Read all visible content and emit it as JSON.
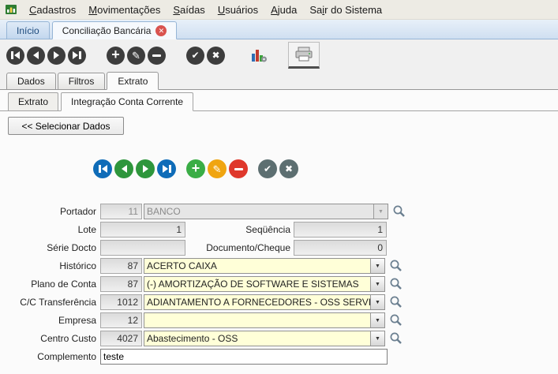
{
  "icons": {
    "close": "✕",
    "plus": "+",
    "pencil": "✎",
    "check": "✔",
    "cancel": "✖",
    "dropdown": "▼"
  },
  "menu": {
    "items": [
      {
        "pre": "",
        "key": "C",
        "rest": "adastros"
      },
      {
        "pre": "",
        "key": "M",
        "rest": "ovimentações"
      },
      {
        "pre": "",
        "key": "S",
        "rest": "aídas"
      },
      {
        "pre": "",
        "key": "U",
        "rest": "suários"
      },
      {
        "pre": "",
        "key": "A",
        "rest": "juda"
      },
      {
        "pre": "Sa",
        "key": "i",
        "rest": "r do Sistema"
      }
    ]
  },
  "tabs": {
    "items": [
      {
        "label": "Início"
      },
      {
        "label": "Conciliação Bancária"
      }
    ]
  },
  "page_tabs": {
    "items": [
      {
        "label": "Dados"
      },
      {
        "label": "Filtros"
      },
      {
        "label": "Extrato"
      }
    ]
  },
  "sub_tabs": {
    "items": [
      {
        "label": "Extrato"
      },
      {
        "label": "Integração Conta Corrente"
      }
    ]
  },
  "actions": {
    "select_data": "<< Selecionar Dados"
  },
  "form": {
    "portador": {
      "label": "Portador",
      "code": "11",
      "value": "BANCO"
    },
    "lote": {
      "label": "Lote",
      "value": "1"
    },
    "sequencia": {
      "label": "Seqüência",
      "value": "1"
    },
    "serie_docto": {
      "label": "Série Docto",
      "value": ""
    },
    "documento_cheque": {
      "label": "Documento/Cheque",
      "value": "0"
    },
    "historico": {
      "label": "Histórico",
      "code": "87",
      "value": "ACERTO CAIXA"
    },
    "plano_conta": {
      "label": "Plano de Conta",
      "code": "87",
      "value": "(-) AMORTIZAÇÃO DE SOFTWARE E SISTEMAS"
    },
    "cc_transferencia": {
      "label": "C/C Transferência",
      "code": "1012",
      "value": "ADIANTAMENTO A FORNECEDORES - OSS SERVIÇ"
    },
    "empresa": {
      "label": "Empresa",
      "code": "12",
      "value": ""
    },
    "centro_custo": {
      "label": "Centro Custo",
      "code": "4027",
      "value": "Abastecimento - OSS"
    },
    "complemento": {
      "label": "Complemento",
      "value": "teste"
    }
  }
}
